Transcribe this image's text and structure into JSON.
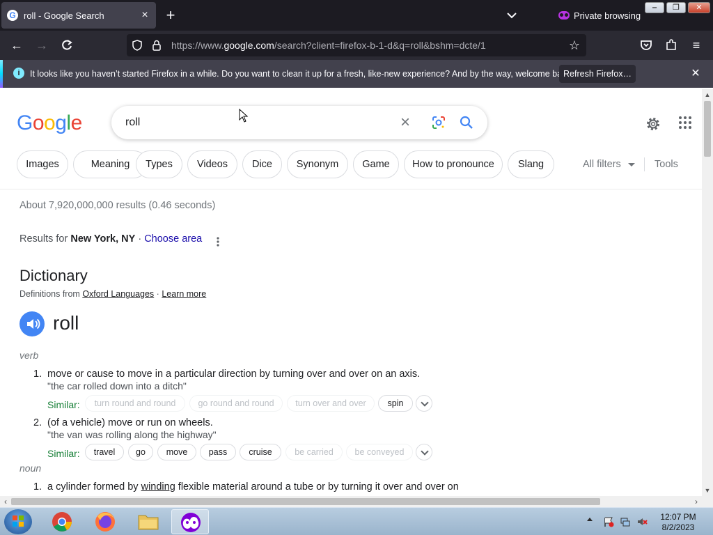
{
  "browser": {
    "tab": {
      "title": "roll - Google Search"
    },
    "private_label": "Private browsing",
    "url": {
      "prefix": "https://www.",
      "domain": "google.com",
      "path": "/search?client=firefox-b-1-d&q=roll&bshm=dcte/1"
    },
    "notification": {
      "message": "It looks like you haven’t started Firefox in a while. Do you want to clean it up for a fresh, like-new experience? And by the way, welcome back!",
      "button": "Refresh Firefox…"
    }
  },
  "search": {
    "query": "roll",
    "chips": [
      "Images",
      "Meaning",
      "Types",
      "Videos",
      "Dice",
      "Synonym",
      "Game",
      "How to pronounce",
      "Slang"
    ],
    "all_filters": "All filters",
    "tools": "Tools",
    "stats": "About 7,920,000,000 results (0.46 seconds)",
    "results_for_prefix": "Results for",
    "location": "New York, NY",
    "separator": "·",
    "choose_area": "Choose area"
  },
  "dictionary": {
    "title": "Dictionary",
    "from_prefix": "Definitions from",
    "source": "Oxford Languages",
    "dot": "·",
    "learn_more": "Learn more",
    "word": "roll",
    "pos_verb": "verb",
    "def1_num": "1.",
    "def1_text": "move or cause to move in a particular direction by turning over and over on an axis.",
    "def1_example": "\"the car rolled down into a ditch\"",
    "similar_label": "Similar:",
    "def1_syns": [
      "turn round and round",
      "go round and round",
      "turn over and over",
      "spin"
    ],
    "def2_num": "2.",
    "def2_text": "(of a vehicle) move or run on wheels.",
    "def2_example": "\"the van was rolling along the highway\"",
    "def2_syns": [
      "travel",
      "go",
      "move",
      "pass",
      "cruise",
      "be carried",
      "be conveyed"
    ],
    "pos_noun": "noun",
    "noun1_num": "1.",
    "noun1_pre": "a cylinder formed by ",
    "noun1_link": "winding",
    "noun1_post": " flexible material around a tube or by turning it over and over on"
  },
  "taskbar": {
    "time": "12:07 PM",
    "date": "8/2/2023"
  },
  "colors": {
    "google_blue": "#4285f4",
    "google_red": "#ea4335",
    "google_yellow": "#fbbc05",
    "google_green": "#34a853",
    "link": "#1a0dab",
    "similar_green": "#188038"
  }
}
